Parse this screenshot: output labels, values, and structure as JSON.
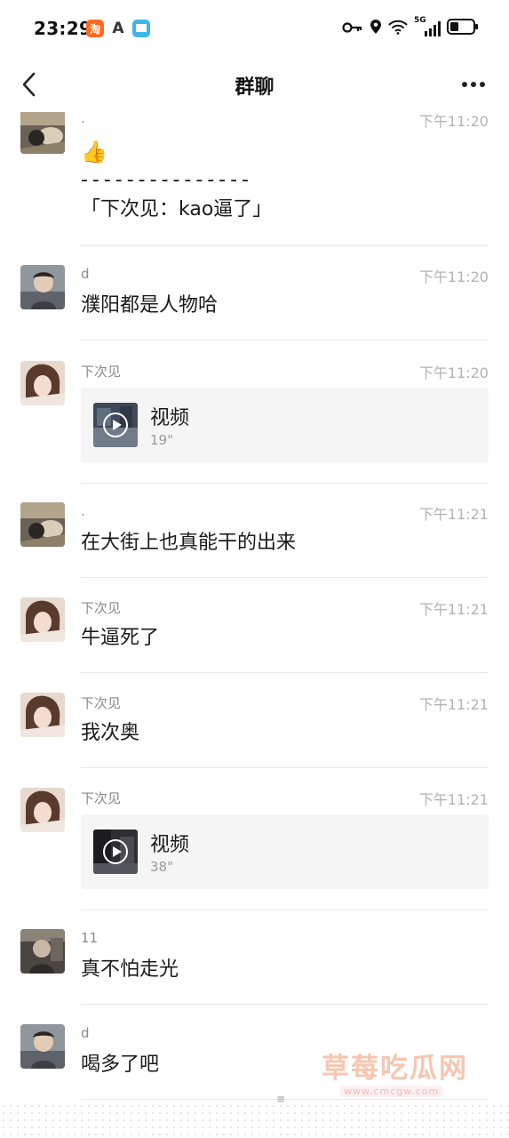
{
  "status_bar": {
    "time": "23:29",
    "network": "5G",
    "icons": [
      "taobao-icon",
      "font-app-icon",
      "book-app-icon",
      "key-icon",
      "location-icon",
      "wifi-icon",
      "signal-icon",
      "battery-icon"
    ]
  },
  "nav": {
    "title": "群聊",
    "back_icon": "chevron-left-icon",
    "more_icon": "more-dots-icon"
  },
  "messages": [
    {
      "sender": ".",
      "time": "下午11:20",
      "lines": [
        "👍",
        "- - - - - - - - - - - - - - -",
        "「下次见：kao逼了」"
      ]
    },
    {
      "sender": "d",
      "time": "下午11:20",
      "text": "濮阳都是人物哈"
    },
    {
      "sender": "下次见",
      "time": "下午11:20",
      "video": {
        "label": "视频",
        "duration": "19\""
      }
    },
    {
      "sender": ".",
      "time": "下午11:21",
      "text": "在大街上也真能干的出来"
    },
    {
      "sender": "下次见",
      "time": "下午11:21",
      "text": "牛逼死了"
    },
    {
      "sender": "下次见",
      "time": "下午11:21",
      "text": "我次奥"
    },
    {
      "sender": "下次见",
      "time": "下午11:21",
      "video": {
        "label": "视频",
        "duration": "38\""
      }
    },
    {
      "sender": "11",
      "time": "",
      "text": "真不怕走光"
    },
    {
      "sender": "d",
      "time": "",
      "text": "喝多了吧"
    }
  ],
  "watermark": {
    "text": "草莓吃瓜网",
    "url": "www.cmcgw.com"
  },
  "scroll_handle": "≡",
  "colors": {
    "time": "#b2b2b2",
    "sender": "#8a8a8a",
    "card_bg": "#f5f5f5",
    "divider": "#e9e9e9"
  }
}
